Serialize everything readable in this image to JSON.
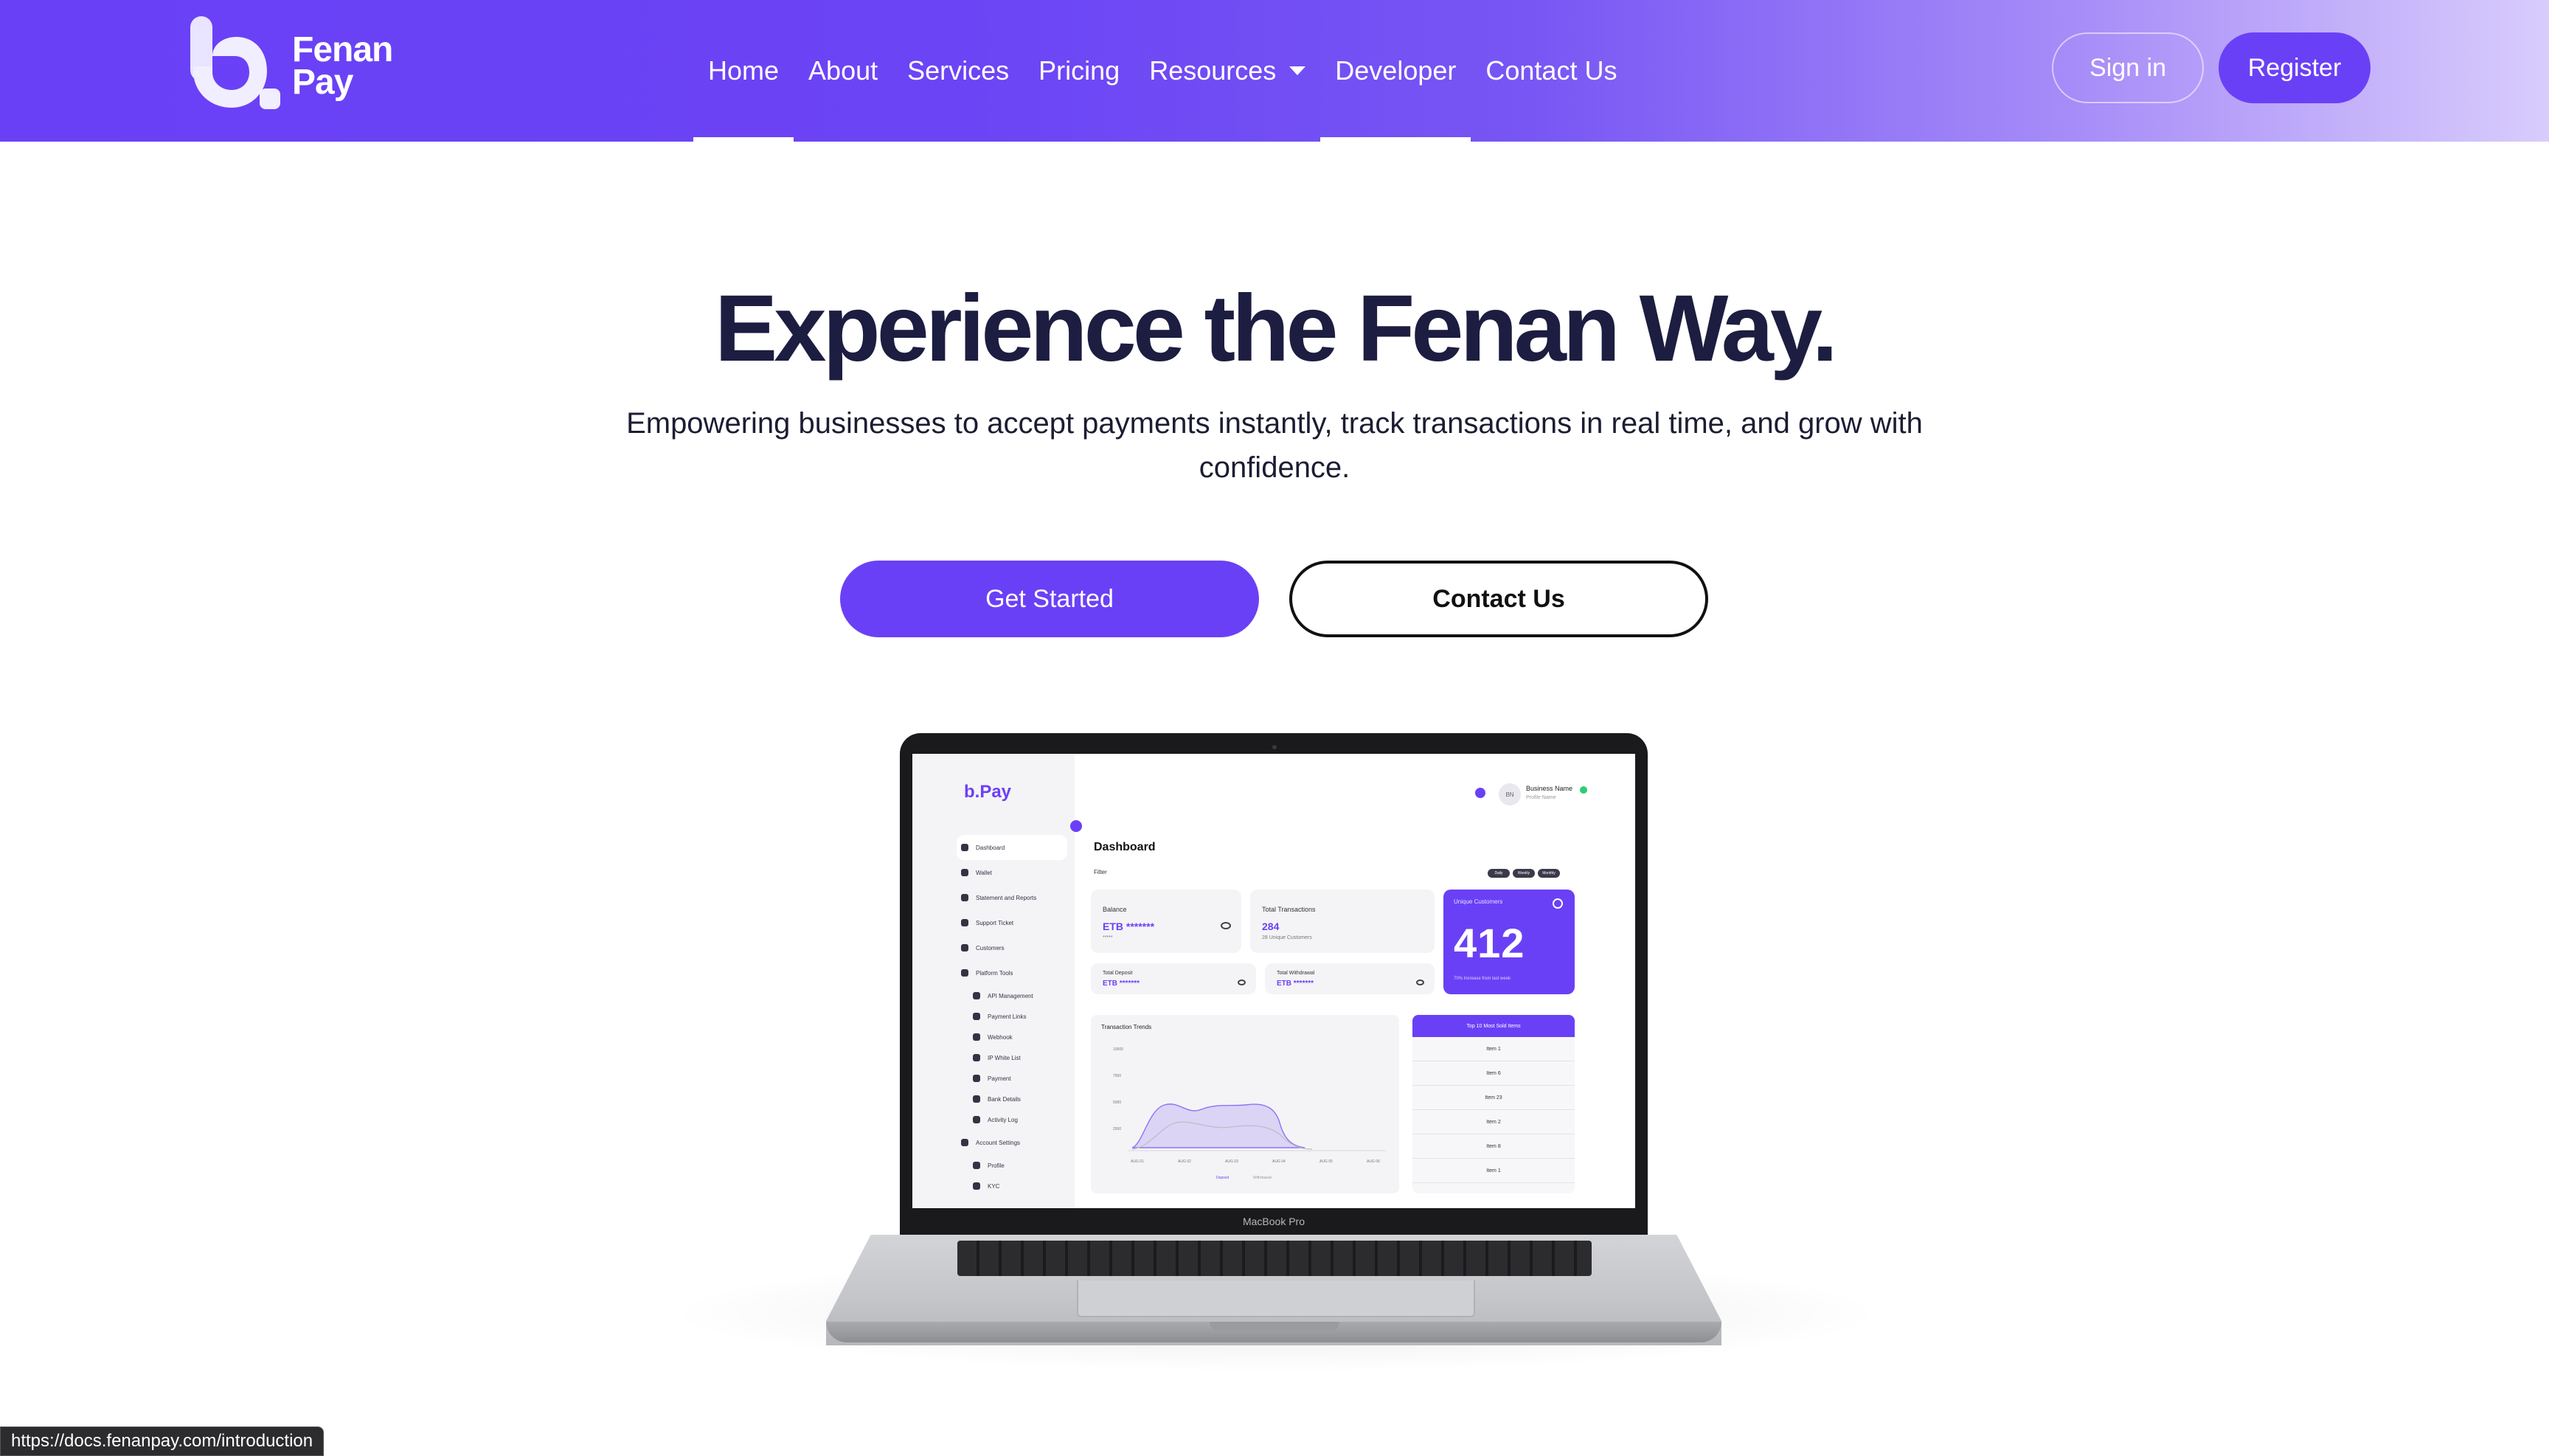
{
  "header": {
    "logo": {
      "line1": "Fenan",
      "line2": "Pay"
    },
    "nav": [
      {
        "label": "Home",
        "active": true
      },
      {
        "label": "About"
      },
      {
        "label": "Services"
      },
      {
        "label": "Pricing"
      },
      {
        "label": "Resources",
        "dropdown": true
      },
      {
        "label": "Developer",
        "active": true
      },
      {
        "label": "Contact Us"
      }
    ],
    "signin_label": "Sign in",
    "register_label": "Register"
  },
  "hero": {
    "title": "Experience the Fenan Way.",
    "subtitle": "Empowering businesses to accept payments instantly, track transactions in real time, and grow with confidence.",
    "primary_cta": "Get Started",
    "secondary_cta": "Contact Us"
  },
  "laptop": {
    "model_label": "MacBook Pro",
    "dashboard": {
      "brand": "b.Pay",
      "sidebar": [
        {
          "label": "Dashboard",
          "selected": true
        },
        {
          "label": "Wallet"
        },
        {
          "label": "Statement and Reports"
        },
        {
          "label": "Support Ticket"
        },
        {
          "label": "Customers"
        },
        {
          "label": "Platform Tools"
        },
        {
          "label": "API Management",
          "sub": true
        },
        {
          "label": "Payment Links",
          "sub": true
        },
        {
          "label": "Webhook",
          "sub": true
        },
        {
          "label": "IP White List",
          "sub": true
        },
        {
          "label": "Payment",
          "sub": true
        },
        {
          "label": "Bank Details",
          "sub": true
        },
        {
          "label": "Activity Log",
          "sub": true
        },
        {
          "label": "Account Settings"
        },
        {
          "label": "Profile",
          "sub": true
        },
        {
          "label": "KYC",
          "sub": true
        }
      ],
      "avatar_initials": "BN",
      "business_name": "Business Name",
      "business_role": "Profile Name",
      "title": "Dashboard",
      "filter_label": "Filter",
      "pills": [
        "Daily",
        "Weekly",
        "Monthly"
      ],
      "balance": {
        "label": "Balance",
        "value": "ETB *******",
        "hint": "*****"
      },
      "total_transactions": {
        "label": "Total Transactions",
        "value": "284",
        "hint": "28 Unique Customers"
      },
      "total_deposit": {
        "label": "Total Deposit",
        "value": "ETB *******"
      },
      "total_withdrawal": {
        "label": "Total Withdrawal",
        "value": "ETB *******"
      },
      "unique_customers": {
        "label": "Unique Customers",
        "value": "412",
        "hint": "70% Increase from last week"
      },
      "trend": {
        "title": "Transaction Trends",
        "legend": [
          "Deposit",
          "Withdrawal"
        ],
        "x_labels": [
          "AUG 01",
          "AUG 02",
          "AUG 03",
          "AUG 04",
          "AUG 05",
          "AUG 06"
        ],
        "y_labels": [
          "10000",
          "7500",
          "5000",
          "2500"
        ]
      },
      "top10": {
        "title": "Top 10 Most Sold Items",
        "items": [
          "Item 1",
          "Item 6",
          "Item 23",
          "Item 2",
          "Item 8",
          "Item 1"
        ]
      }
    }
  },
  "statusbar": {
    "url": "https://docs.fenanpay.com/introduction"
  },
  "colors": {
    "brand": "#6a40f6",
    "brand_light": "#d8ccfc",
    "text_dark": "#1c1d40"
  }
}
